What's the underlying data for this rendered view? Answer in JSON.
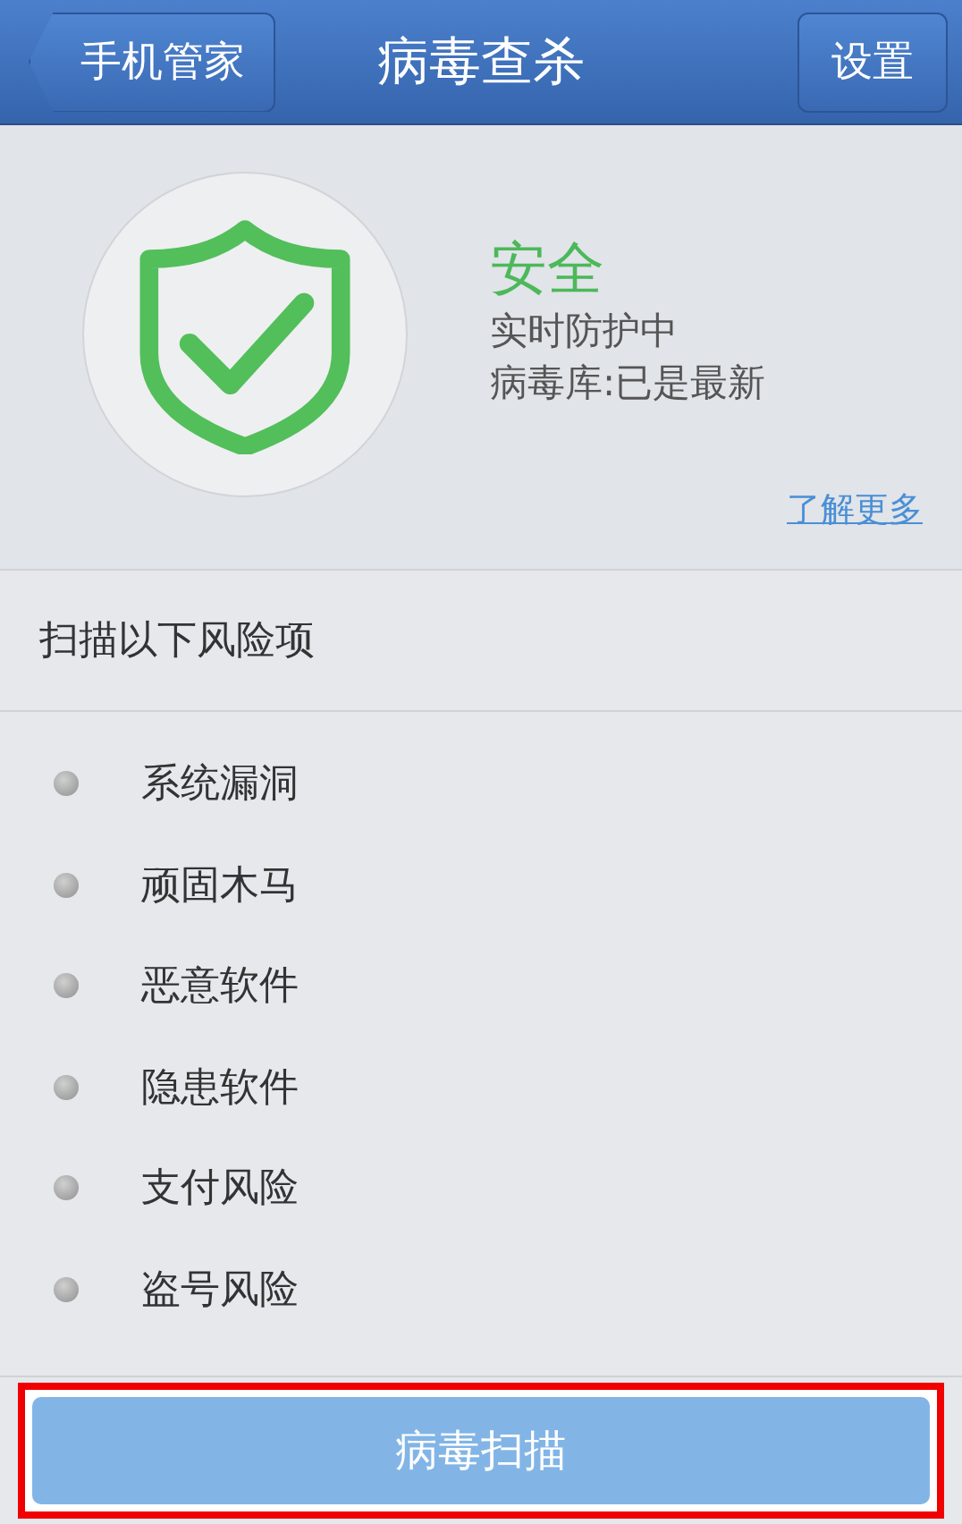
{
  "nav_bar": {
    "back_button": "手机管家",
    "title": "病毒查杀",
    "settings_button": "设置"
  },
  "status": {
    "state": "安全",
    "lines": [
      "实时防护中",
      "病毒库:已是最新"
    ],
    "link": "了解更多"
  },
  "section_title": "扫描以下风险项",
  "risk_items": [
    "系统漏洞",
    "顽固木马",
    "恶意软件",
    "隐患软件",
    "支付风险",
    "盗号风险"
  ],
  "scan_button": {
    "label": "病毒扫描",
    "highlighted": true
  }
}
